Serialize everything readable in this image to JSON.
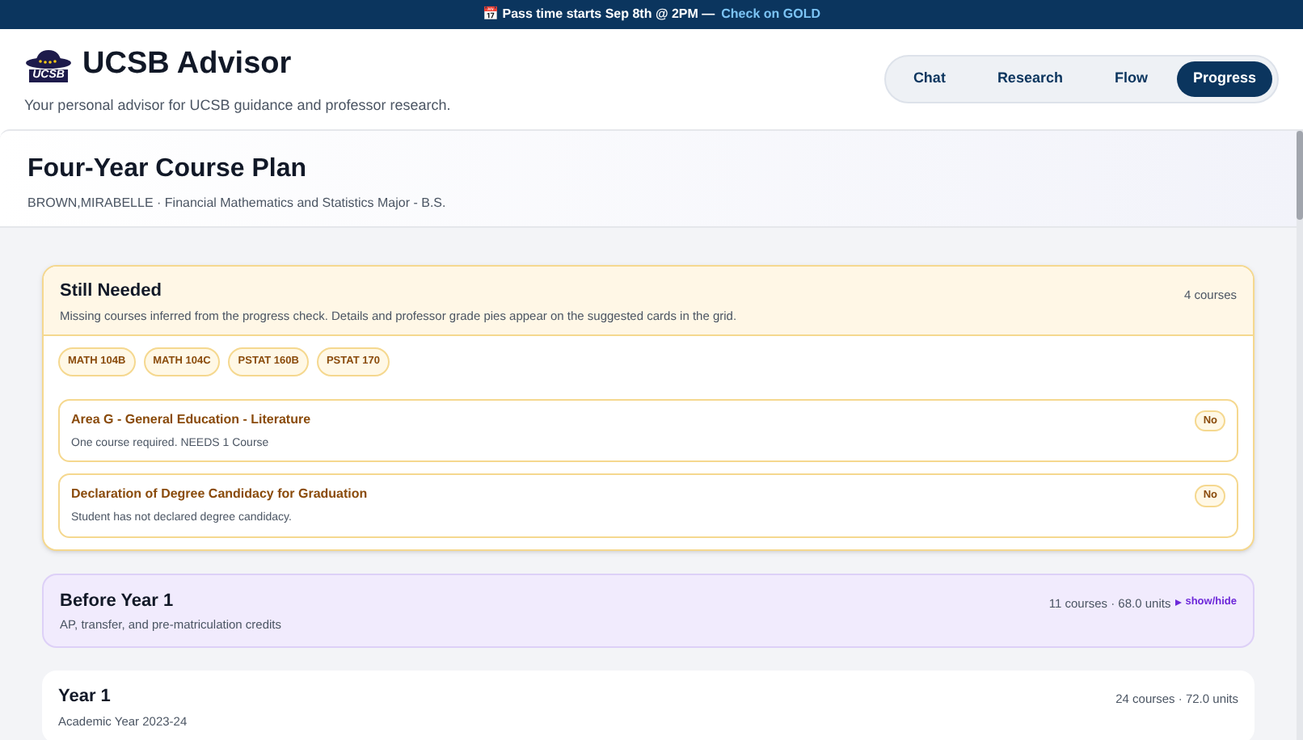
{
  "banner": {
    "text": "📅 Pass time starts Sep 8th @ 2PM —",
    "link": "Check on GOLD"
  },
  "header": {
    "logo_text": "UCSB",
    "title": "UCSB Advisor",
    "subtitle": "Your personal advisor for UCSB guidance and professor research."
  },
  "tabs": [
    {
      "label": "Chat",
      "selected": false
    },
    {
      "label": "Research",
      "selected": false
    },
    {
      "label": "Flow",
      "selected": false
    },
    {
      "label": "Progress",
      "selected": true
    }
  ],
  "plan": {
    "title": "Four-Year Course Plan",
    "subtitle": "BROWN,MIRABELLE · Financial Mathematics and Statistics Major - B.S."
  },
  "still_needed": {
    "title": "Still Needed",
    "description": "Missing courses inferred from the progress check. Details and professor grade pies appear on the suggested cards in the grid.",
    "count": "4 courses",
    "courses": [
      "MATH 104B",
      "MATH 104C",
      "PSTAT 160B",
      "PSTAT 170"
    ],
    "requirements": [
      {
        "title": "Area G - General Education - Literature",
        "detail": "One course required. NEEDS 1 Course",
        "status": "No"
      },
      {
        "title": "Declaration of Degree Candidacy for Graduation",
        "detail": "Student has not declared degree candidacy.",
        "status": "No"
      }
    ]
  },
  "sections": [
    {
      "kind": "transfer",
      "title": "Before Year 1",
      "subtitle": "AP, transfer, and pre-matriculation credits",
      "summary": "11 courses · 68.0 units",
      "toggle": "show/hide"
    },
    {
      "kind": "year",
      "title": "Year 1",
      "subtitle": "Academic Year 2023-24",
      "summary": "24 courses · 72.0 units"
    }
  ]
}
